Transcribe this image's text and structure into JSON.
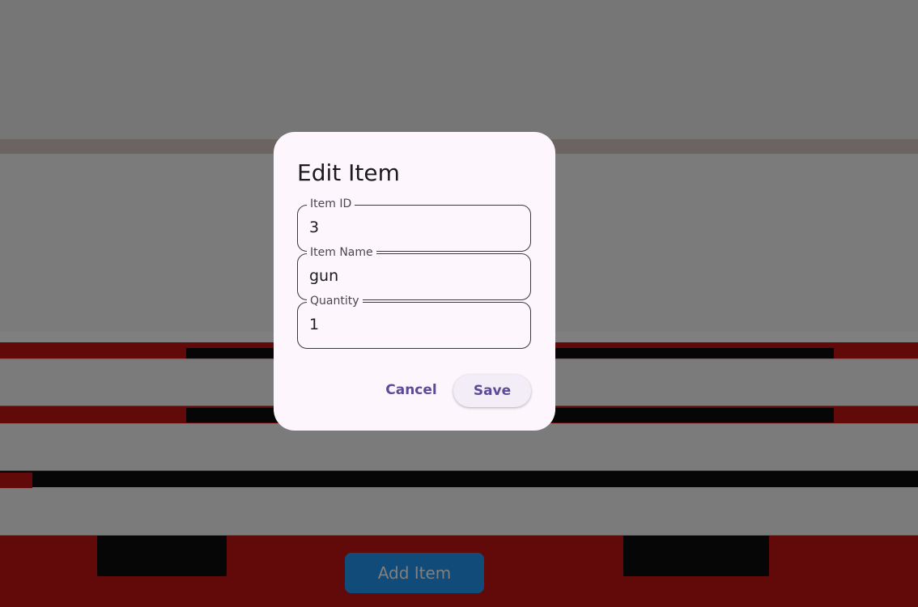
{
  "dialog": {
    "title": "Edit Item",
    "fields": [
      {
        "label": "Item ID",
        "value": "3"
      },
      {
        "label": "Item Name",
        "value": "gun"
      },
      {
        "label": "Quantity",
        "value": "1"
      }
    ],
    "cancel_label": "Cancel",
    "save_label": "Save"
  },
  "main": {
    "add_item_label": "Add Item"
  },
  "colors": {
    "accent": "#2196f3",
    "dialog_action": "#5d4b98",
    "dialog_surface": "#fdf6fd"
  }
}
